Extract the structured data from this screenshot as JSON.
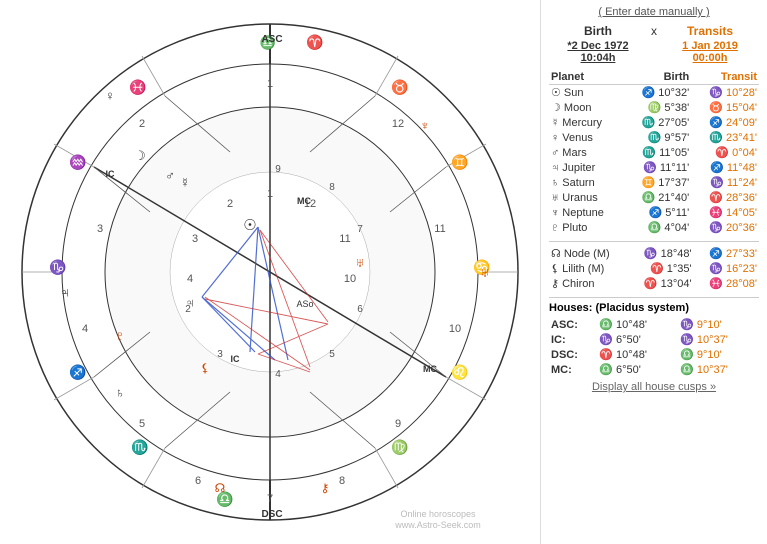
{
  "enter_date_label": "( Enter date manually )",
  "header": {
    "birth_label": "Birth",
    "x_label": "x",
    "transit_label": "Transits",
    "birth_date": "*2 Dec 1972",
    "birth_time": "10:04h",
    "transit_date": "1 Jan 2019",
    "transit_time": "00:00h"
  },
  "columns": {
    "planet": "Planet",
    "birth": "Birth",
    "transit": "Transit"
  },
  "planets": [
    {
      "name": "Sun",
      "symbol": "☉",
      "birth_sign": "♐",
      "birth_deg": "10°32'",
      "transit_sign": "♑",
      "transit_deg": "10°28'"
    },
    {
      "name": "Moon",
      "symbol": "☽",
      "birth_sign": "♍",
      "birth_deg": "5°38'",
      "transit_sign": "♉",
      "transit_deg": "15°04'"
    },
    {
      "name": "Mercury",
      "symbol": "☿",
      "birth_sign": "♏",
      "birth_deg": "27°05'",
      "transit_sign": "♐",
      "transit_deg": "24°09'"
    },
    {
      "name": "Venus",
      "symbol": "♀",
      "birth_sign": "♏",
      "birth_deg": "9°57'",
      "transit_sign": "♏",
      "transit_deg": "23°41'"
    },
    {
      "name": "Mars",
      "symbol": "♂",
      "birth_sign": "♏",
      "birth_deg": "11°05'",
      "transit_sign": "♈",
      "transit_deg": "0°04'"
    },
    {
      "name": "Jupiter",
      "symbol": "♃",
      "birth_sign": "♑",
      "birth_deg": "11°11'",
      "transit_sign": "♐",
      "transit_deg": "11°48'"
    },
    {
      "name": "Saturn",
      "symbol": "♄",
      "birth_sign": "♊",
      "birth_deg": "17°37'",
      "transit_sign": "♑",
      "transit_deg": "11°24'"
    },
    {
      "name": "Uranus",
      "symbol": "♅",
      "birth_sign": "♎",
      "birth_deg": "21°40'",
      "transit_sign": "♈",
      "transit_deg": "28°36'"
    },
    {
      "name": "Neptune",
      "symbol": "♆",
      "birth_sign": "♐",
      "birth_deg": "5°11'",
      "transit_sign": "♓",
      "transit_deg": "14°05'"
    },
    {
      "name": "Pluto",
      "symbol": "♇",
      "birth_sign": "♎",
      "birth_deg": "4°04'",
      "transit_sign": "♑",
      "transit_deg": "20°36'"
    }
  ],
  "special_points": [
    {
      "name": "Node (M)",
      "symbol": "☊",
      "birth_sign": "♑",
      "birth_deg": "18°48'",
      "transit_sign": "♐",
      "transit_deg": "27°33'"
    },
    {
      "name": "Lilith (M)",
      "symbol": "⚸",
      "birth_sign": "♈",
      "birth_deg": "1°35'",
      "transit_sign": "♑",
      "transit_deg": "16°23'"
    },
    {
      "name": "Chiron",
      "symbol": "⚷",
      "birth_sign": "♈",
      "birth_deg": "13°04'",
      "transit_sign": "♓",
      "transit_deg": "28°08'"
    }
  ],
  "houses_header": "Houses: (Placidus system)",
  "houses": [
    {
      "label": "ASC:",
      "birth_sign": "♎",
      "birth_deg": "10°48'",
      "transit_sign": "♑",
      "transit_deg": "9°10'"
    },
    {
      "label": "IC:",
      "birth_sign": "♑",
      "birth_deg": "6°50'",
      "transit_sign": "♑",
      "transit_deg": "10°37'"
    },
    {
      "label": "DSC:",
      "birth_sign": "♈",
      "birth_deg": "10°48'",
      "transit_sign": "♎",
      "transit_deg": "9°10'"
    },
    {
      "label": "MC:",
      "birth_sign": "♎",
      "birth_deg": "6°50'",
      "transit_sign": "♎",
      "transit_deg": "10°37'"
    }
  ],
  "display_all_link": "Display all house cusps »",
  "watermark_line1": "Online horoscopes",
  "watermark_line2": "www.Astro-Seek.com"
}
